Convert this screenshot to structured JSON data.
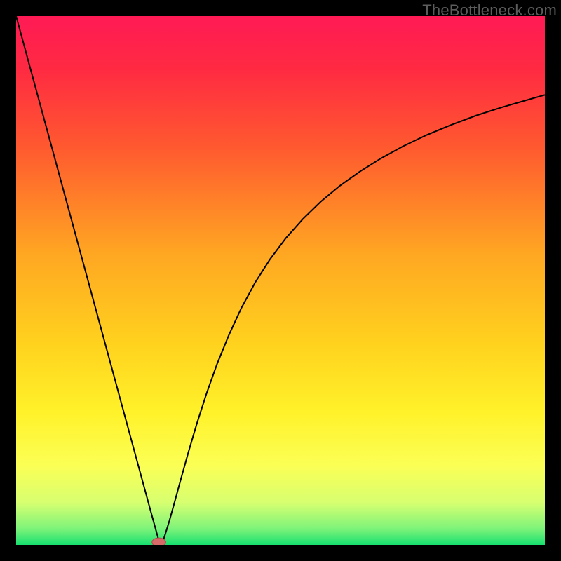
{
  "watermark": "TheBottleneck.com",
  "chart_data": {
    "type": "line",
    "title": "",
    "xlabel": "",
    "ylabel": "",
    "xlim": [
      0,
      100
    ],
    "ylim": [
      0,
      100
    ],
    "grid": false,
    "legend": false,
    "gradient_stops": [
      {
        "pos": 0.0,
        "color": "#ff1a55"
      },
      {
        "pos": 0.1,
        "color": "#ff2a42"
      },
      {
        "pos": 0.25,
        "color": "#ff5a2f"
      },
      {
        "pos": 0.45,
        "color": "#ffa722"
      },
      {
        "pos": 0.62,
        "color": "#ffd21e"
      },
      {
        "pos": 0.75,
        "color": "#fff22a"
      },
      {
        "pos": 0.85,
        "color": "#fbff55"
      },
      {
        "pos": 0.92,
        "color": "#d7ff70"
      },
      {
        "pos": 0.97,
        "color": "#7cf37a"
      },
      {
        "pos": 1.0,
        "color": "#17e070"
      }
    ],
    "series": [
      {
        "name": "left-arm",
        "stroke": "#000000",
        "x": [
          0.0,
          2.8,
          5.6,
          8.4,
          11.2,
          14.0,
          16.8,
          19.6,
          22.4,
          25.2,
          26.6,
          27.0,
          27.4
        ],
        "y": [
          100.0,
          89.7,
          79.4,
          69.1,
          58.8,
          48.5,
          38.2,
          27.9,
          17.6,
          7.3,
          2.2,
          0.8,
          0.0
        ]
      },
      {
        "name": "right-arm",
        "stroke": "#000000",
        "x": [
          27.4,
          27.8,
          28.2,
          29.0,
          30.0,
          31.2,
          32.6,
          34.2,
          36.0,
          38.0,
          40.2,
          42.6,
          45.2,
          48.0,
          51.0,
          54.2,
          57.6,
          61.2,
          65.0,
          69.0,
          73.2,
          77.6,
          82.2,
          87.0,
          92.0,
          97.2,
          100.0
        ],
        "y": [
          0.0,
          0.8,
          2.0,
          4.6,
          8.2,
          12.6,
          17.6,
          23.0,
          28.6,
          34.2,
          39.6,
          44.8,
          49.6,
          54.0,
          58.0,
          61.6,
          64.9,
          67.9,
          70.6,
          73.1,
          75.4,
          77.5,
          79.4,
          81.2,
          82.8,
          84.3,
          85.1
        ]
      }
    ],
    "marker": {
      "x": 27.0,
      "y": 0.5,
      "rx": 1.3,
      "ry": 0.8,
      "fill": "#d86a6a",
      "stroke": "#b84e4e"
    }
  }
}
